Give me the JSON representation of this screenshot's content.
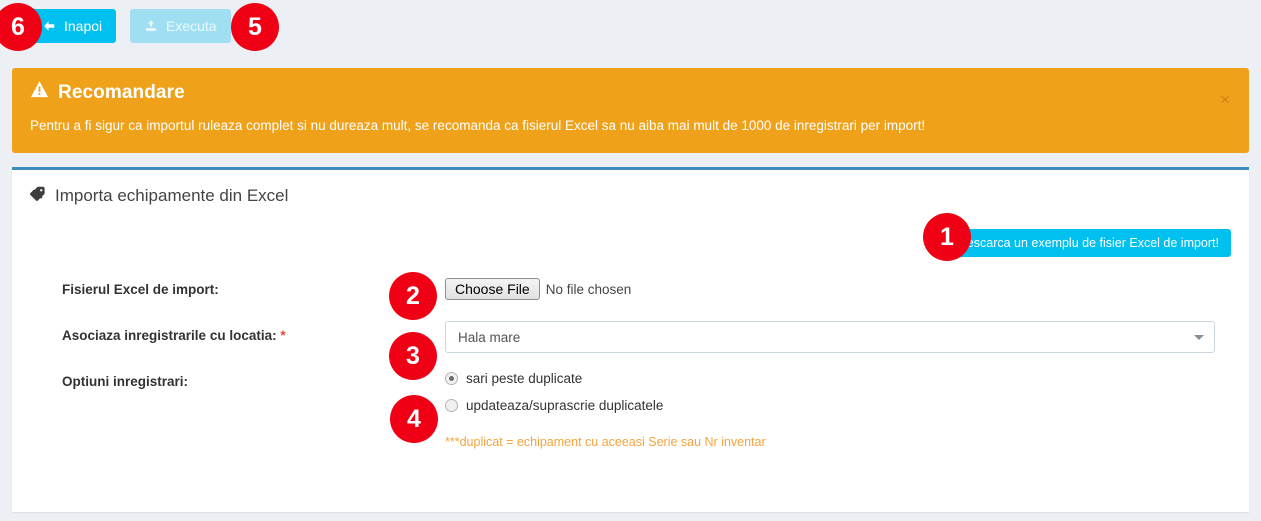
{
  "toolbar": {
    "back_label": "Inapoi",
    "back_icon": "arrow-left-icon",
    "execute_label": "Executa",
    "execute_icon": "upload-icon"
  },
  "alert": {
    "icon": "warning-triangle-icon",
    "title": "Recomandare",
    "message": "Pentru a fi sigur ca importul ruleaza complet si nu dureaza mult, se recomanda ca fisierul Excel sa nu aiba mai mult de 1000 de inregistrari per import!",
    "close_label": "×",
    "background_color": "#f0a11a"
  },
  "panel": {
    "icon": "tag-icon",
    "title": "Importa echipamente din Excel",
    "accent_color": "#3c8dbc",
    "download_button_label": "Descarca un exemplu de fisier Excel de import!",
    "download_button_color": "#00c0ef"
  },
  "form": {
    "file": {
      "label": "Fisierul Excel de import:",
      "choose_button_label": "Choose File",
      "file_status": "No file chosen"
    },
    "location": {
      "label": "Asociaza inregistrarile cu locatia:",
      "required_marker": "*",
      "selected_value": "Hala mare",
      "caret_icon": "chevron-down-icon"
    },
    "options": {
      "label": "Optiuni inregistrari:",
      "choices": [
        {
          "label": "sari peste duplicate",
          "selected": true
        },
        {
          "label": "updateaza/suprascrie duplicatele",
          "selected": false
        }
      ],
      "hint": "***duplicat = echipament cu aceeasi Serie sau Nr inventar",
      "hint_color": "#f5a33c"
    }
  },
  "callouts": [
    {
      "id": "1",
      "number": "1"
    },
    {
      "id": "2",
      "number": "2"
    },
    {
      "id": "3",
      "number": "3"
    },
    {
      "id": "4",
      "number": "4"
    },
    {
      "id": "5",
      "number": "5"
    },
    {
      "id": "6",
      "number": "6"
    }
  ]
}
